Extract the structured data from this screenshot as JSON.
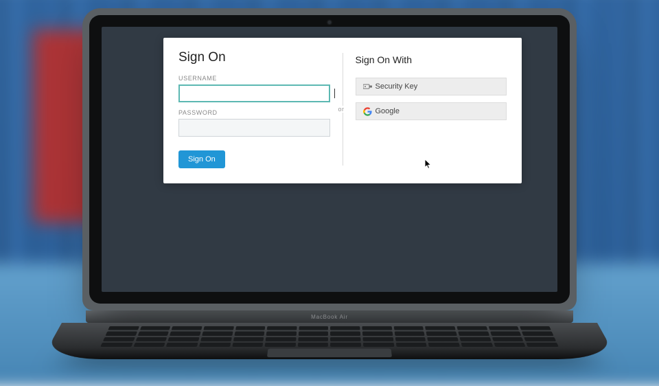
{
  "signon": {
    "title": "Sign On",
    "username_label": "USERNAME",
    "username_value": "",
    "password_label": "PASSWORD",
    "password_value": "",
    "submit_label": "Sign On"
  },
  "divider": {
    "or_label": "or"
  },
  "federated": {
    "title": "Sign On With",
    "providers": [
      {
        "id": "security-key",
        "label": "Security Key"
      },
      {
        "id": "google",
        "label": "Google"
      }
    ]
  },
  "device": {
    "brand_label": "MacBook Air"
  }
}
